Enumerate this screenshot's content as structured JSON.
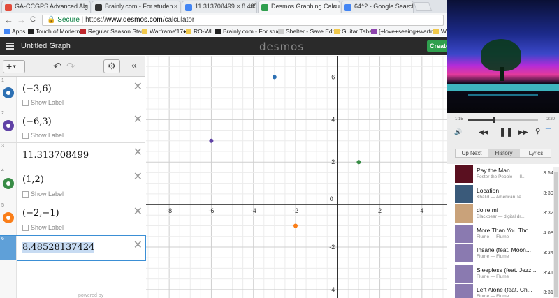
{
  "browser": {
    "tabs": [
      {
        "label": "GA-CCGPS Advanced Alg",
        "favicon_color": "#e24b3b",
        "active": false
      },
      {
        "label": "Brainly.com - For studen",
        "favicon_color": "#333333",
        "active": false
      },
      {
        "label": "11.313708499 × 8.48528",
        "favicon_color": "#4285f4",
        "active": false
      },
      {
        "label": "Desmos Graphing Calcul",
        "favicon_color": "#2f9f4e",
        "active": true
      },
      {
        "label": "64^2 - Google Search",
        "favicon_color": "#4285f4",
        "active": false
      }
    ],
    "tab_close": "×",
    "nav": {
      "back": "←",
      "forward": "→",
      "reload": "C"
    },
    "address": {
      "secure_label": "Secure",
      "separator": "|",
      "scheme": "https://",
      "domain": "www.desmos.com",
      "path": "/calculator"
    },
    "bookmarks": [
      {
        "label": "Apps",
        "icon_color": "#4285f4"
      },
      {
        "label": "Touch of Modern",
        "icon_color": "#222222"
      },
      {
        "label": "Regular Season Stand",
        "icon_color": "#c0282d"
      },
      {
        "label": "Warframe'17♦",
        "icon_color": "#f0c84b"
      },
      {
        "label": "RO-WL",
        "icon_color": "#f0c84b"
      },
      {
        "label": "Brainly.com - For stud",
        "icon_color": "#222222"
      },
      {
        "label": "Shelter - Save Editor",
        "icon_color": "#cccccc"
      },
      {
        "label": "Guitar Tabs",
        "icon_color": "#f0c84b"
      },
      {
        "label": "[+love+seeing+warfr",
        "icon_color": "#8e44ad"
      },
      {
        "label": "Wa",
        "icon_color": "#f0c84b"
      }
    ]
  },
  "desmos": {
    "graph_title": "Untitled Graph",
    "logo": "desmos",
    "create_label": "Create",
    "add_label": "+",
    "show_label_text": "Show Label",
    "powered_by": "powered by",
    "expressions": [
      {
        "index": "1",
        "latex": "(−3,6)",
        "color": "#2d70b3",
        "has_label_toggle": true
      },
      {
        "index": "2",
        "latex": "(−6,3)",
        "color": "#6042a6",
        "has_label_toggle": true
      },
      {
        "index": "3",
        "latex": "11.313708499",
        "color": "",
        "has_label_toggle": false
      },
      {
        "index": "4",
        "latex": "(1,2)",
        "color": "#388c46",
        "has_label_toggle": true
      },
      {
        "index": "5",
        "latex": "(−2,−1)",
        "color": "#fa7e19",
        "has_label_toggle": true
      },
      {
        "index": "6",
        "latex": "8.48528137424",
        "color": "",
        "has_label_toggle": false
      }
    ],
    "graph": {
      "xlim": [
        -9.1,
        5.2
      ],
      "ylim": [
        -4.4,
        7.0
      ],
      "x_ticks": [
        "-8",
        "-6",
        "-4",
        "-2",
        "0",
        "2",
        "4"
      ],
      "y_ticks": [
        "6",
        "4",
        "2",
        "-2",
        "-4"
      ],
      "points": [
        {
          "x": -3,
          "y": 6,
          "color": "#2d70b3"
        },
        {
          "x": -6,
          "y": 3,
          "color": "#6042a6"
        },
        {
          "x": 1,
          "y": 2,
          "color": "#388c46"
        },
        {
          "x": -2,
          "y": -1,
          "color": "#fa7e19"
        }
      ]
    }
  },
  "player": {
    "time_current": "1:15",
    "time_remaining": "-2:20",
    "progress_fraction": 0.36,
    "controls": {
      "volume": "🔊",
      "prev": "◀◀",
      "pause": "❚❚",
      "next": "▶▶",
      "search": "⚲",
      "list": "☰"
    },
    "tabs": [
      {
        "label": "Up Next",
        "selected": false
      },
      {
        "label": "History",
        "selected": true
      },
      {
        "label": "Lyrics",
        "selected": false
      }
    ],
    "tracks": [
      {
        "title": "Pay the Man",
        "artist": "Foster the People — II...",
        "duration": "3:54",
        "thumb_color": "#5a1020"
      },
      {
        "title": "Location",
        "artist": "Khalid — American Te...",
        "duration": "3:39",
        "thumb_color": "#3a5a7a"
      },
      {
        "title": "do re mi",
        "artist": "Blackbear — digital dr...",
        "duration": "3:32",
        "thumb_color": "#c9a27a"
      },
      {
        "title": "More Than You Tho...",
        "artist": "Flume — Flume",
        "duration": "4:08",
        "thumb_color": "#8a7ab0"
      },
      {
        "title": "Insane (feat. Moon...",
        "artist": "Flume — Flume",
        "duration": "3:34",
        "thumb_color": "#8a7ab0"
      },
      {
        "title": "Sleepless (feat. Jezz...",
        "artist": "Flume — Flume",
        "duration": "3:41",
        "thumb_color": "#8a7ab0"
      },
      {
        "title": "Left Alone (feat. Ch...",
        "artist": "Flume — Flume",
        "duration": "3:31",
        "thumb_color": "#8a7ab0"
      }
    ]
  }
}
